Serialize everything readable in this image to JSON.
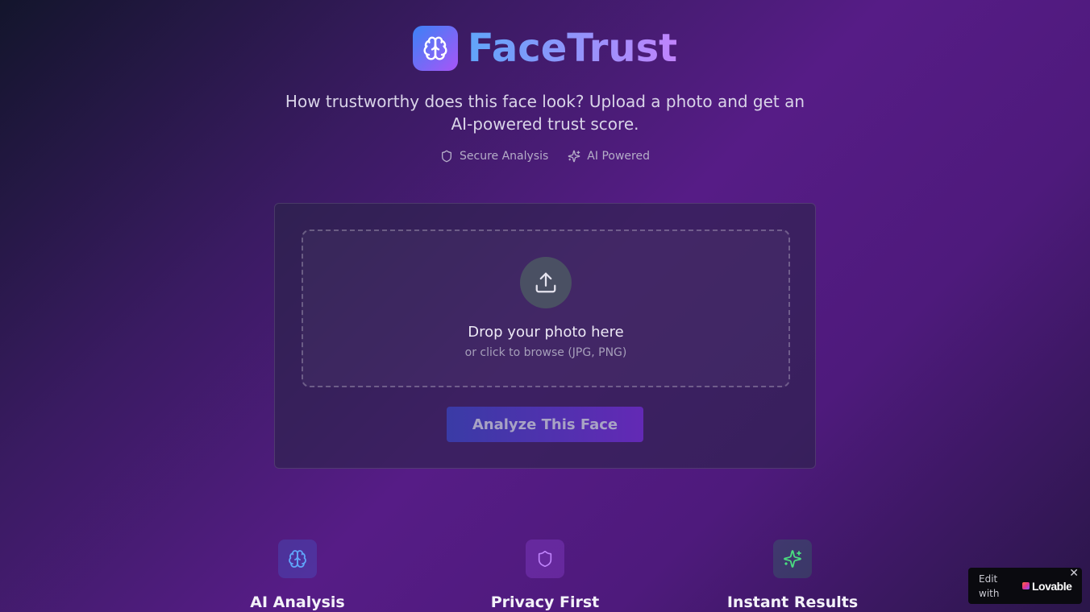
{
  "header": {
    "brand": "FaceTrust",
    "logo_icon": "brain-icon",
    "subtitle_line1": "How trustworthy does this face look? Upload a photo and get an",
    "subtitle_line2": "AI-powered trust score."
  },
  "badges": [
    {
      "icon": "shield-icon",
      "label": "Secure Analysis"
    },
    {
      "icon": "sparkles-icon",
      "label": "AI Powered"
    }
  ],
  "upload": {
    "icon": "upload-icon",
    "title": "Drop your photo here",
    "subtitle": "or click to browse (JPG, PNG)"
  },
  "analyze_button": "Analyze This Face",
  "features": [
    {
      "icon": "brain-icon",
      "title": "AI Analysis",
      "color": "#60a5fa"
    },
    {
      "icon": "shield-icon",
      "title": "Privacy First",
      "color": "#c084fc"
    },
    {
      "icon": "sparkles-icon",
      "title": "Instant Results",
      "color": "#4ade80"
    }
  ],
  "lovable_badge": {
    "prefix": "Edit with",
    "brand": "Lovable",
    "close": "✕"
  },
  "colors": {
    "accent_blue": "#3b82f6",
    "accent_purple": "#a855f7"
  }
}
